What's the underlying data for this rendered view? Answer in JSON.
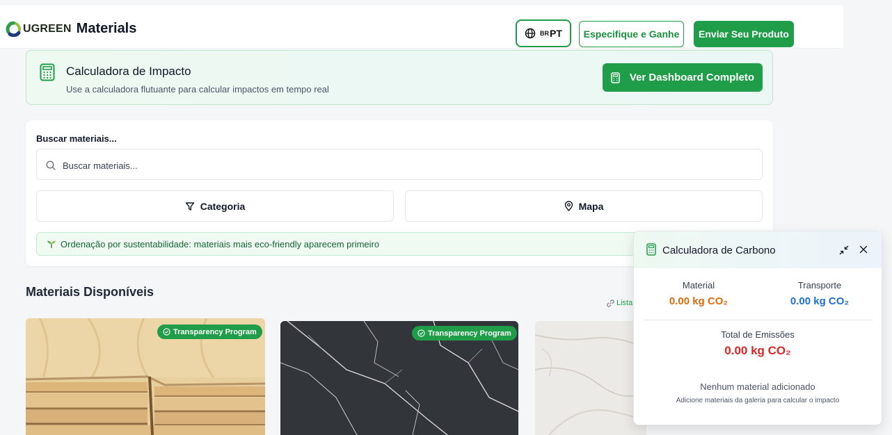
{
  "header": {
    "brand": "UGREEN",
    "app_name": "Materials",
    "language_flag": "BR",
    "language_code": "PT",
    "spec_button": "Especifique e Ganhe",
    "send_button": "Enviar Seu Produto"
  },
  "impact_banner": {
    "title": "Calculadora de Impacto",
    "subtitle": "Use a calculadora flutuante para calcular impactos em tempo real",
    "button": "Ver Dashboard Completo"
  },
  "search": {
    "label": "Buscar materiais...",
    "placeholder": "Buscar materiais...",
    "category_button": "Categoria",
    "map_button": "Mapa",
    "sort_note": "Ordenação por sustentabilidade: materiais mais eco-friendly aparecem primeiro"
  },
  "materials": {
    "section_title": "Materiais Disponíveis",
    "view_link": "Lista",
    "cards": [
      {
        "badge": "Transparency Program"
      },
      {
        "badge": "Transparency Program"
      },
      {
        "badge": ""
      }
    ]
  },
  "carbon_calculator": {
    "title": "Calculadora de Carbono",
    "material_label": "Material",
    "material_value": "0.00 kg CO₂",
    "transport_label": "Transporte",
    "transport_value": "0.00 kg CO₂",
    "total_label": "Total de Emissões",
    "total_value": "0.00 kg CO₂",
    "empty_title": "Nenhum material adicionado",
    "empty_subtitle": "Adicione materiais da galeria para calcular o impacto"
  },
  "colors": {
    "brand_green": "#1f9d48",
    "material_orange": "#dd6b0c",
    "transport_blue": "#1f6fd1",
    "total_red": "#dc2626"
  }
}
